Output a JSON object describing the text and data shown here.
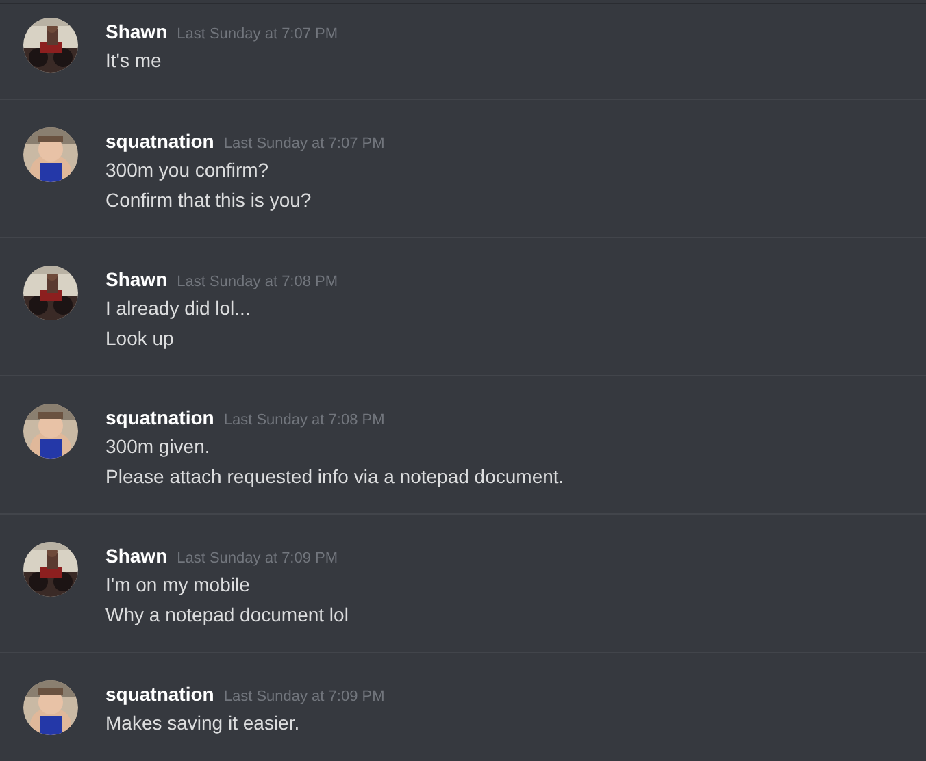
{
  "messages": [
    {
      "author": "Shawn",
      "timestamp": "Last Sunday at 7:07 PM",
      "avatar": {
        "kind": "picture"
      },
      "lines": [
        "It's me"
      ]
    },
    {
      "author": "squatnation",
      "timestamp": "Last Sunday at 7:07 PM",
      "avatar": {
        "kind": "picture"
      },
      "lines": [
        "300m you confirm?",
        "Confirm that this is you?"
      ]
    },
    {
      "author": "Shawn",
      "timestamp": "Last Sunday at 7:08 PM",
      "avatar": {
        "kind": "picture"
      },
      "lines": [
        "I already did lol...",
        "Look up"
      ]
    },
    {
      "author": "squatnation",
      "timestamp": "Last Sunday at 7:08 PM",
      "avatar": {
        "kind": "picture"
      },
      "lines": [
        "300m given.",
        "Please attach requested info via a notepad document."
      ]
    },
    {
      "author": "Shawn",
      "timestamp": "Last Sunday at 7:09 PM",
      "avatar": {
        "kind": "picture"
      },
      "lines": [
        "I'm on my mobile",
        "Why a notepad document lol"
      ]
    },
    {
      "author": "squatnation",
      "timestamp": "Last Sunday at 7:09 PM",
      "avatar": {
        "kind": "picture"
      },
      "lines": [
        "Makes saving it easier."
      ]
    }
  ]
}
